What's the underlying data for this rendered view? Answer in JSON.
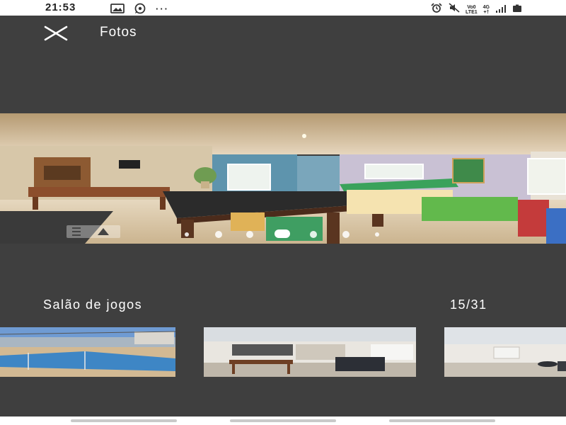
{
  "status_bar": {
    "time": "21:53",
    "overflow": "···",
    "network_line1": "Vo0",
    "network_line2": "LTE1",
    "network_type": "4G",
    "network_sub": "+†",
    "left_icons": [
      "gallery-icon",
      "whatsapp-icon"
    ],
    "right_icons": [
      "alarm-icon",
      "mute-icon",
      "signal-icon",
      "battery-icon"
    ]
  },
  "header": {
    "title": "Fotos",
    "close_icon": "close-icon"
  },
  "photo": {
    "caption": "Salão de jogos",
    "counter": "15/31",
    "watermark_icon": "logo-icon",
    "pager_dot_count": 7,
    "pager_active_index": 3
  },
  "thumbnails": [
    {
      "name": "thumbnail-sports-court"
    },
    {
      "name": "thumbnail-party-hall"
    },
    {
      "name": "thumbnail-lounge"
    }
  ],
  "colors": {
    "background": "#3f3f3f",
    "text": "#ffffff",
    "status_bar": "#ffffff"
  }
}
